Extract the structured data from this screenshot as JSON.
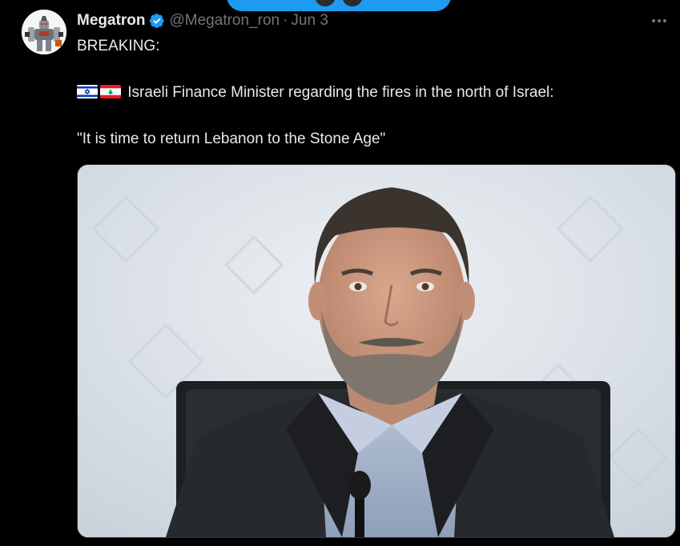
{
  "tweet": {
    "display_name": "Megatron",
    "handle": "@Megatron_ron",
    "separator": "·",
    "date": "Jun 3",
    "lines": [
      "BREAKING:",
      "Israeli Finance Minister regarding the fires in the north of Israel:",
      "\"It is time to return Lebanon to the Stone Age\""
    ],
    "flags": [
      "israel-flag",
      "lebanon-flag"
    ],
    "media_alt": "",
    "icons": {
      "verified": "verified-badge-icon",
      "more": "more-dots-icon"
    }
  },
  "colors": {
    "background": "#000000",
    "primary_text": "#e7e9ea",
    "secondary_text": "#71767b",
    "accent": "#1d9bf0"
  }
}
